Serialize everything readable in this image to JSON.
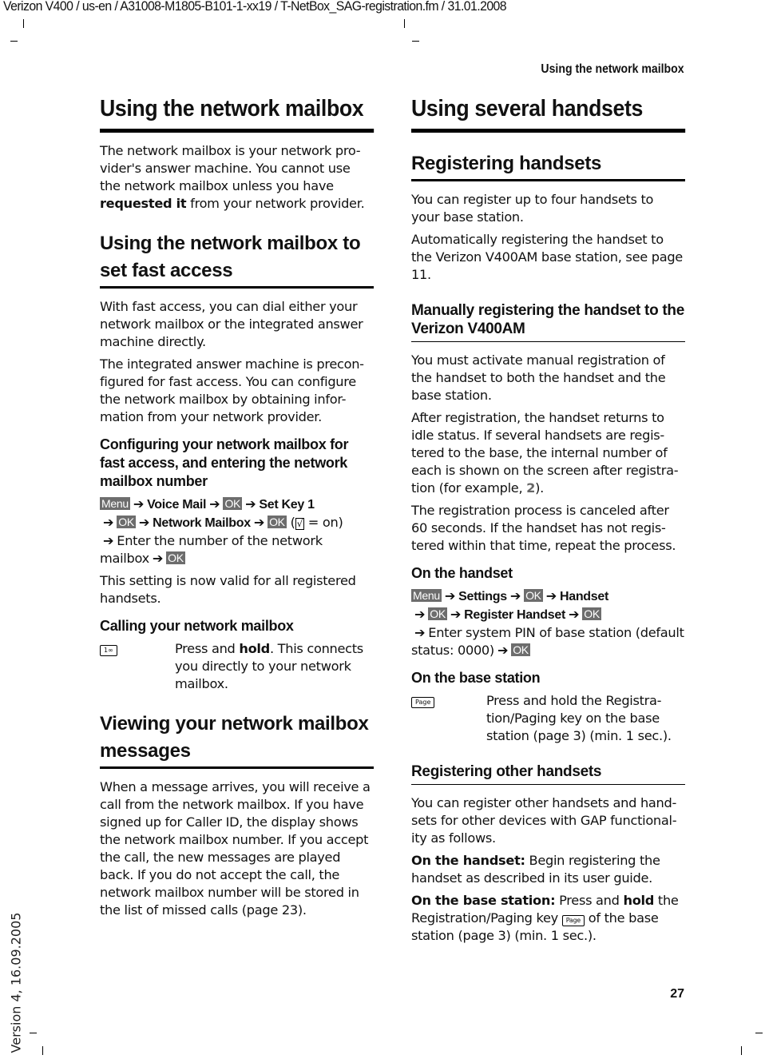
{
  "document_meta": "Verizon V400 / us-en / A31008-M1805-B101-1-xx19 / T-NetBox_SAG-registration.fm / 31.01.2008",
  "running_head": "Using the network mailbox",
  "page_number": "27",
  "version": "Version 4, 16.09.2005",
  "left": {
    "title": "Using the network mailbox",
    "intro_pre": "The network mailbox is your network pro-vider's answer machine. You cannot use the network mailbox unless you have ",
    "intro_bold": "requested it",
    "intro_post": " from your network provider.",
    "fast_access": {
      "heading": "Using the network mailbox to set fast access",
      "p1": "With fast access, you can dial either your network mailbox or the integrated answer machine directly.",
      "p2": "The integrated answer machine is precon-figured for fast access. You can configure the network mailbox by obtaining infor-mation from your network provider.",
      "subheading": "Configuring your network mailbox for fast access, and entering the network mailbox number",
      "steps": {
        "menu": "Menu",
        "voice_mail": "Voice Mail",
        "ok": "OK",
        "set_key": "Set Key 1",
        "network_mailbox": "Network Mailbox",
        "check_note_open": "(",
        "check_glyph": "√",
        "check_note_close": " = on)",
        "enter": "Enter the number of the network mailbox"
      },
      "valid_note": "This setting is now valid for all registered handsets."
    },
    "calling": {
      "heading": "Calling your network mailbox",
      "key_label": "1∞",
      "text_pre": "Press and ",
      "text_bold": "hold",
      "text_post": ". This connects you directly to your network mailbox."
    },
    "viewing": {
      "heading": "Viewing your network mailbox messages",
      "text": "When a message arrives, you will receive a call from the network mailbox. If you have signed up for Caller ID, the display shows the network mailbox number. If you accept the call, the new messages are played back. If you do not accept the call, the network mailbox number will be stored in the list of missed calls (page 23)."
    }
  },
  "right": {
    "title": "Using several handsets",
    "registering": {
      "heading": "Registering handsets",
      "p1": "You can register up to four handsets to your base station.",
      "p2": "Automatically registering the handset to the Verizon V400AM base station, see page 11."
    },
    "manual": {
      "heading": "Manually registering the handset to the Verizon V400AM",
      "p1": "You must activate manual registration of the handset to both the handset and the base station.",
      "p2_pre": "After registration, the handset returns to idle status. If several handsets are regis-tered to the base, the internal number of each is shown on the screen after registra-tion (for example, ",
      "p2_num": "2",
      "p2_post": ").",
      "p3": "The registration process is canceled after 60 seconds. If the handset has not regis-tered within that time, repeat the process.",
      "on_handset": {
        "heading": "On the handset",
        "menu": "Menu",
        "settings": "Settings",
        "ok": "OK",
        "handset": "Handset",
        "register_handset": "Register  Handset",
        "enter": "Enter system PIN of base station (default status: 0000)"
      },
      "on_base": {
        "heading": "On the base station",
        "key_label": "Page",
        "text": "Press and hold the Registra-tion/Paging key on the base station (page 3) (min. 1 sec.)."
      }
    },
    "other": {
      "heading": "Registering other handsets",
      "p1": "You can register other handsets and hand-sets for other devices with GAP functional-ity as follows.",
      "handset_label": "On the handset:",
      "handset_text": " Begin registering the handset as described in its user guide.",
      "base_label": "On the base station:",
      "base_pre": " Press and ",
      "base_bold": "hold",
      "base_mid": " the Registration/Paging key ",
      "base_key": "Page",
      "base_post": " of the base station (page 3) (min. 1 sec.)."
    }
  }
}
